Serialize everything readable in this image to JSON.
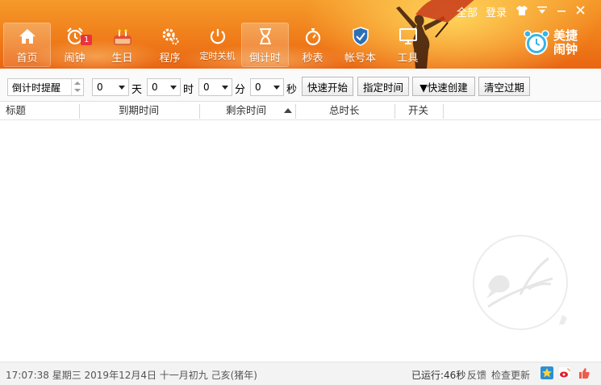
{
  "header": {
    "topbar": {
      "all": "全部",
      "login": "登录",
      "skin_icon": "shirt-icon",
      "menu_icon": "menu-icon"
    },
    "nav": [
      {
        "label": "首页",
        "icon": "home-icon"
      },
      {
        "label": "闹钟",
        "icon": "alarm-clock-icon",
        "badge": "1"
      },
      {
        "label": "生日",
        "icon": "cake-icon"
      },
      {
        "label": "程序",
        "icon": "gear-icon"
      },
      {
        "label": "定时关机",
        "icon": "power-icon"
      },
      {
        "label": "倒计时",
        "icon": "hourglass-icon"
      },
      {
        "label": "秒表",
        "icon": "stopwatch-icon"
      },
      {
        "label": "帐号本",
        "icon": "shield-icon"
      },
      {
        "label": "工具",
        "icon": "monitor-icon"
      }
    ],
    "brand": {
      "name": "美捷闹钟"
    }
  },
  "toolbar": {
    "reminder_type": "倒计时提醒",
    "days_value": "0",
    "days_unit": "天",
    "hours_value": "0",
    "hours_unit": "时",
    "minutes_value": "0",
    "minutes_unit": "分",
    "seconds_value": "0",
    "seconds_unit": "秒",
    "quick_start": "快速开始",
    "set_time": "指定时间",
    "quick_create": "▼快速创建",
    "clear_expired": "清空过期"
  },
  "table": {
    "columns": [
      "标题",
      "到期时间",
      "剩余时间",
      "总时长",
      "开关"
    ],
    "sorted_column": "剩余时间",
    "sort_direction": "asc",
    "rows": []
  },
  "status": {
    "datetime": "17:07:38 星期三 2019年12月4日 十一月初九 己亥(猪年)",
    "running": "已运行:46秒",
    "feedback": "反馈",
    "check_update": "检查更新"
  },
  "colors": {
    "header_orange": "#f07d1a",
    "badge_red": "#e8323c"
  }
}
